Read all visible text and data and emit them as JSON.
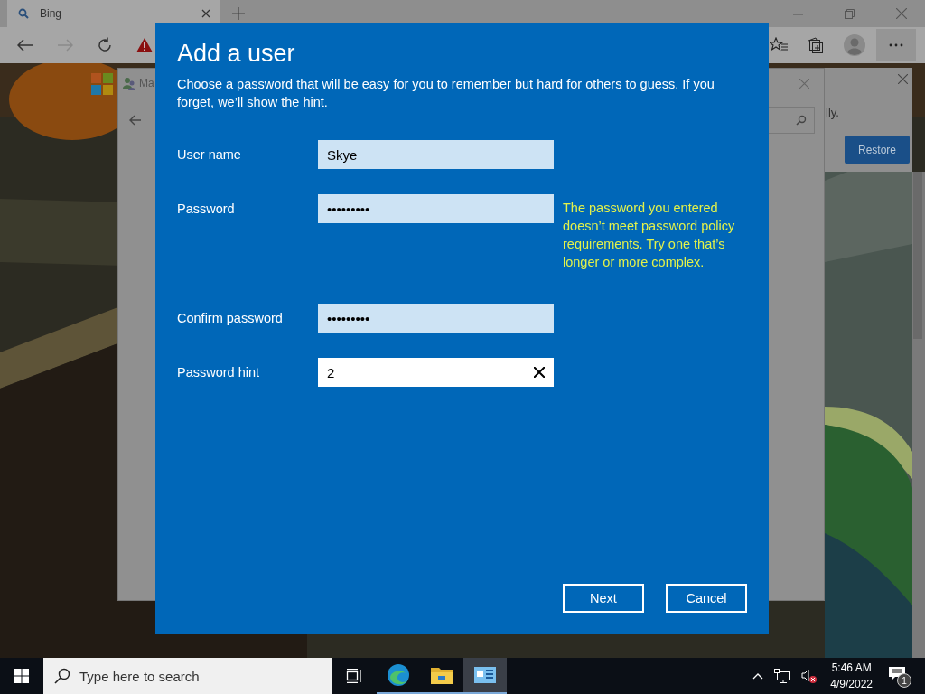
{
  "browser": {
    "tab": {
      "title": "Bing"
    },
    "forward_disabled": true
  },
  "settings_window": {
    "title": "Ma"
  },
  "notice": {
    "text": "lly.",
    "button": "Restore"
  },
  "dialog": {
    "title": "Add a user",
    "description": "Choose a password that will be easy for you to remember but hard for others to guess. If you forget, we’ll show the hint.",
    "fields": [
      {
        "label": "User name",
        "value": "Skye",
        "focused": false
      },
      {
        "label": "Password",
        "value": "•••••••••",
        "focused": false,
        "error": "The password you entered doesn’t meet password policy requirements. Try one that’s longer or more complex."
      },
      {
        "label": "Confirm password",
        "value": "•••••••••",
        "focused": false
      },
      {
        "label": "Password hint",
        "value": "2",
        "focused": true
      }
    ],
    "buttons": [
      "Next",
      "Cancel"
    ]
  },
  "taskbar": {
    "search": {
      "placeholder": "Type here to search"
    },
    "time": "5:46 AM",
    "date": "4/9/2022",
    "notification_count": "1"
  }
}
